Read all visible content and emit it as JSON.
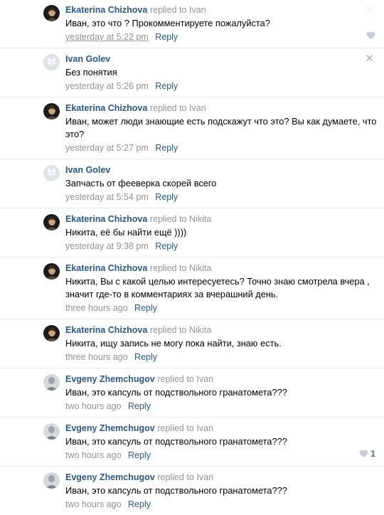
{
  "colors": {
    "author": "#2a5885",
    "link": "#2a5885",
    "muted": "#939393",
    "divider": "#e7e8ec",
    "like_icon": "#c5ced9"
  },
  "comments": [
    {
      "author": "Ekaterina Chizhova",
      "replied": "replied to",
      "reply_to": "Ivan",
      "text": "Иван, это что ? Прокомментируете пожалуйста?",
      "time": "yesterday at 5:22 pm",
      "reply": "Reply",
      "avatar_icon": "dark-portrait-avatar",
      "has_like": true,
      "like_count": ""
    },
    {
      "author": "Ivan Golev",
      "replied": "",
      "reply_to": "",
      "text": "Без понятия",
      "time": "yesterday at 5:26 pm",
      "reply": "Reply",
      "avatar_icon": "default-dog-avatar",
      "has_like": false
    },
    {
      "author": "Ekaterina Chizhova",
      "replied": "replied to",
      "reply_to": "Ivan",
      "text": "Иван, может люди знающие есть подскажут что это? Вы как думаете, что это?",
      "time": "yesterday at 5:27 pm",
      "reply": "Reply",
      "avatar_icon": "dark-portrait-avatar",
      "has_like": false
    },
    {
      "author": "Ivan Golev",
      "replied": "",
      "reply_to": "",
      "text": "Запчасть от фееверка скорей всего",
      "time": "yesterday at 5:54 pm",
      "reply": "Reply",
      "avatar_icon": "default-dog-avatar",
      "has_like": false
    },
    {
      "author": "Ekaterina Chizhova",
      "replied": "replied to",
      "reply_to": "Nikita",
      "text": "Никита, её бы найти ещё ))))",
      "time": "yesterday at 9:38 pm",
      "reply": "Reply",
      "avatar_icon": "dark-portrait-avatar",
      "has_like": false
    },
    {
      "author": "Ekaterina Chizhova",
      "replied": "replied to",
      "reply_to": "Nikita",
      "text": "Никита, Вы с какой целью интересуетесь? Точно знаю смотрела вчера , значит где-то в комментариях за вчерашний день.",
      "time": "three hours ago",
      "reply": "Reply",
      "avatar_icon": "dark-portrait-avatar",
      "has_like": false
    },
    {
      "author": "Ekaterina Chizhova",
      "replied": "replied to",
      "reply_to": "Nikita",
      "text": "Никита, ищу запись не могу пока найти, знаю есть.",
      "time": "three hours ago",
      "reply": "Reply",
      "avatar_icon": "dark-portrait-avatar",
      "has_like": false
    },
    {
      "author": "Evgeny Zhemchugov",
      "replied": "replied to",
      "reply_to": "Ivan",
      "text": "Иван, это капсуль от подствольного гранатомета???",
      "time": "two hours ago",
      "reply": "Reply",
      "avatar_icon": "grey-portrait-avatar",
      "has_like": false
    },
    {
      "author": "Evgeny Zhemchugov",
      "replied": "replied to",
      "reply_to": "Ivan",
      "text": "Иван, это капсуль от подствольного гранатомета???",
      "time": "two hours ago",
      "reply": "Reply",
      "avatar_icon": "grey-portrait-avatar",
      "has_like": true,
      "like_count": "1"
    },
    {
      "author": "Evgeny Zhemchugov",
      "replied": "replied to",
      "reply_to": "Ivan",
      "text": "Иван, это капсуль от подствольного гранатомета???",
      "time": "two hours ago",
      "reply": "Reply",
      "avatar_icon": "grey-portrait-avatar",
      "has_like": false
    }
  ]
}
